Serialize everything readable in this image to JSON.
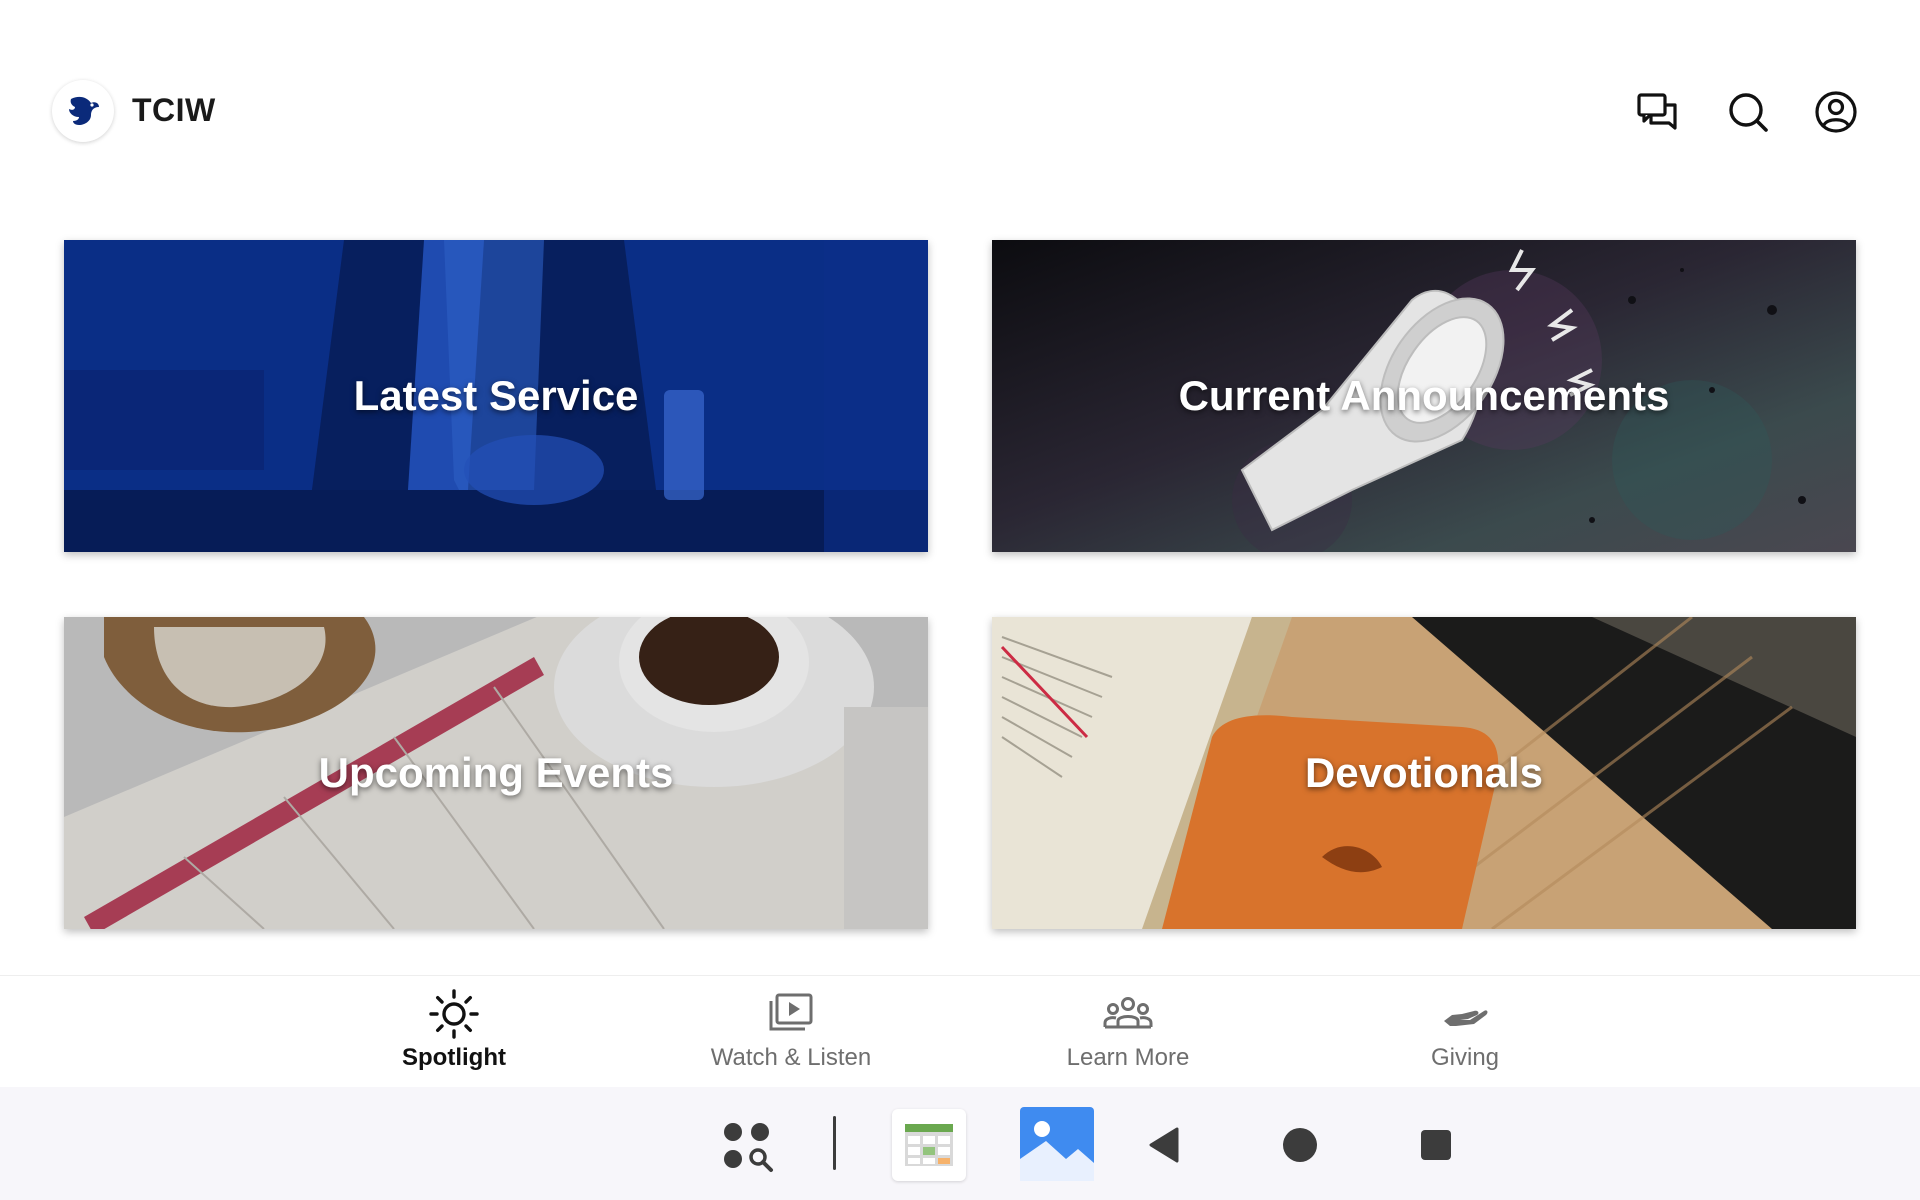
{
  "header": {
    "title": "TCIW",
    "logo_icon": "dove-logo-icon",
    "actions": [
      {
        "icon": "chat-icon"
      },
      {
        "icon": "search-icon"
      },
      {
        "icon": "account-icon"
      }
    ]
  },
  "cards": [
    {
      "label": "Latest Service"
    },
    {
      "label": "Current Announcements"
    },
    {
      "label": "Upcoming Events"
    },
    {
      "label": "Devotionals"
    }
  ],
  "bottom_nav": {
    "active": "Spotlight",
    "items": [
      {
        "label": "Spotlight",
        "icon": "sun-icon"
      },
      {
        "label": "Watch & Listen",
        "icon": "video-library-icon"
      },
      {
        "label": "Learn More",
        "icon": "groups-icon"
      },
      {
        "label": "Giving",
        "icon": "giving-hand-icon"
      }
    ]
  },
  "system_bar": {
    "buttons": [
      {
        "icon": "app-drawer-search-icon"
      },
      {
        "icon": "calendar-app-icon"
      },
      {
        "icon": "gallery-app-icon"
      },
      {
        "icon": "back-icon"
      },
      {
        "icon": "home-icon"
      },
      {
        "icon": "recents-icon"
      }
    ]
  },
  "colors": {
    "accent": "#1a3d8f",
    "brand_navy": "#0b2a7a",
    "text_primary": "#111111",
    "text_secondary": "#6e6e6e"
  }
}
